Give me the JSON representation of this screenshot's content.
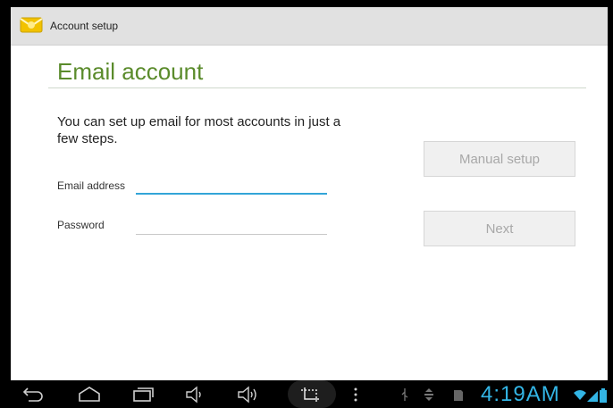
{
  "actionbar": {
    "title": "Account setup",
    "icon": "email-envelope-icon"
  },
  "content": {
    "heading": "Email account",
    "intro": "You can set up email for most accounts in just a few steps.",
    "email_label": "Email address",
    "email_value": "",
    "password_label": "Password",
    "password_value": ""
  },
  "buttons": {
    "manual_setup": "Manual setup",
    "next": "Next"
  },
  "statusbar": {
    "time": "4:19AM"
  },
  "colors": {
    "heading": "#5a8b2b",
    "accent": "#33b5e5",
    "disabled_text": "#a8a8a8"
  }
}
